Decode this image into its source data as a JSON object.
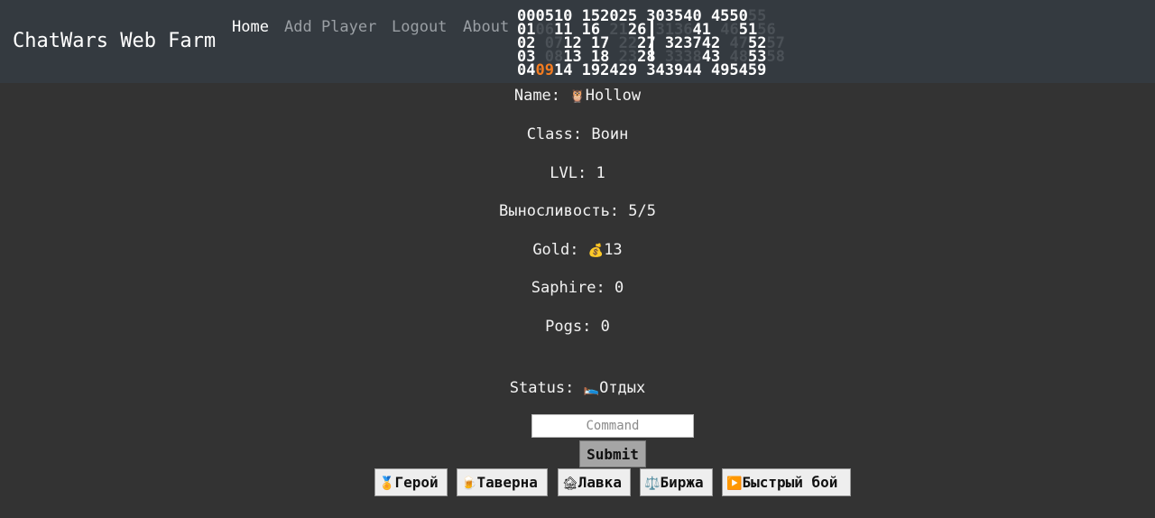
{
  "navbar": {
    "brand": "ChatWars Web Farm",
    "links": [
      "Home",
      "Add Player",
      "Logout",
      "About"
    ]
  },
  "clock": {
    "rows": [
      [
        {
          "t": "000510 152025 ",
          "c": ""
        },
        {
          "t": "303540 4550",
          "c": ""
        },
        {
          "t": "55",
          "c": "dim"
        }
      ],
      [
        {
          "t": "01",
          "c": ""
        },
        {
          "t": "06",
          "c": "dim"
        },
        {
          "t": "11 16 ",
          "c": ""
        },
        {
          "t": "21",
          "c": "dim"
        },
        {
          "t": "26 ",
          "c": ""
        },
        {
          "t": "3136",
          "c": "dim"
        },
        {
          "t": "41 ",
          "c": ""
        },
        {
          "t": "46",
          "c": "dim"
        },
        {
          "t": "51",
          "c": ""
        },
        {
          "t": "56",
          "c": "dim"
        }
      ],
      [
        {
          "t": "02 ",
          "c": ""
        },
        {
          "t": "07",
          "c": "dim"
        },
        {
          "t": "12 17 ",
          "c": ""
        },
        {
          "t": "22",
          "c": "dim"
        },
        {
          "t": "27 323742 ",
          "c": ""
        },
        {
          "t": "47",
          "c": "dim"
        },
        {
          "t": "52",
          "c": ""
        },
        {
          "t": "57",
          "c": "dim"
        }
      ],
      [
        {
          "t": "03 ",
          "c": ""
        },
        {
          "t": "08",
          "c": "dim"
        },
        {
          "t": "13 18 ",
          "c": ""
        },
        {
          "t": "23",
          "c": "dim"
        },
        {
          "t": "28 ",
          "c": ""
        },
        {
          "t": "3338",
          "c": "dim"
        },
        {
          "t": "43 ",
          "c": ""
        },
        {
          "t": "48",
          "c": "dim"
        },
        {
          "t": "53",
          "c": ""
        },
        {
          "t": "58",
          "c": "dim"
        }
      ],
      [
        {
          "t": "04",
          "c": ""
        },
        {
          "t": "09",
          "c": "hl"
        },
        {
          "t": "14 192429 343944 495459",
          "c": ""
        }
      ]
    ]
  },
  "player": {
    "name_label": "Name:",
    "name_icon": "🦉",
    "name_value": "Hollow",
    "class_label": "Class:",
    "class_value": "Воин",
    "lvl_label": "LVL:",
    "lvl_value": "1",
    "stamina_label": "Выносливость:",
    "stamina_value": "5/5",
    "gold_label": "Gold:",
    "gold_icon": "💰",
    "gold_value": "13",
    "saphire_label": "Saphire:",
    "saphire_value": "0",
    "pogs_label": "Pogs:",
    "pogs_value": "0",
    "status_label": "Status:",
    "status_icon": "🛌",
    "status_value": "Отдых"
  },
  "command": {
    "placeholder": "Command",
    "submit_label": "Submit"
  },
  "quick_buttons": [
    {
      "icon": "🏅",
      "label": "Герой"
    },
    {
      "icon": "🍺",
      "label": "Таверна"
    },
    {
      "icon": "🏚",
      "label": "Лавка"
    },
    {
      "icon": "⚖️",
      "label": "Биржа"
    },
    {
      "icon": "▶️",
      "label": "Быстрый бой"
    }
  ]
}
